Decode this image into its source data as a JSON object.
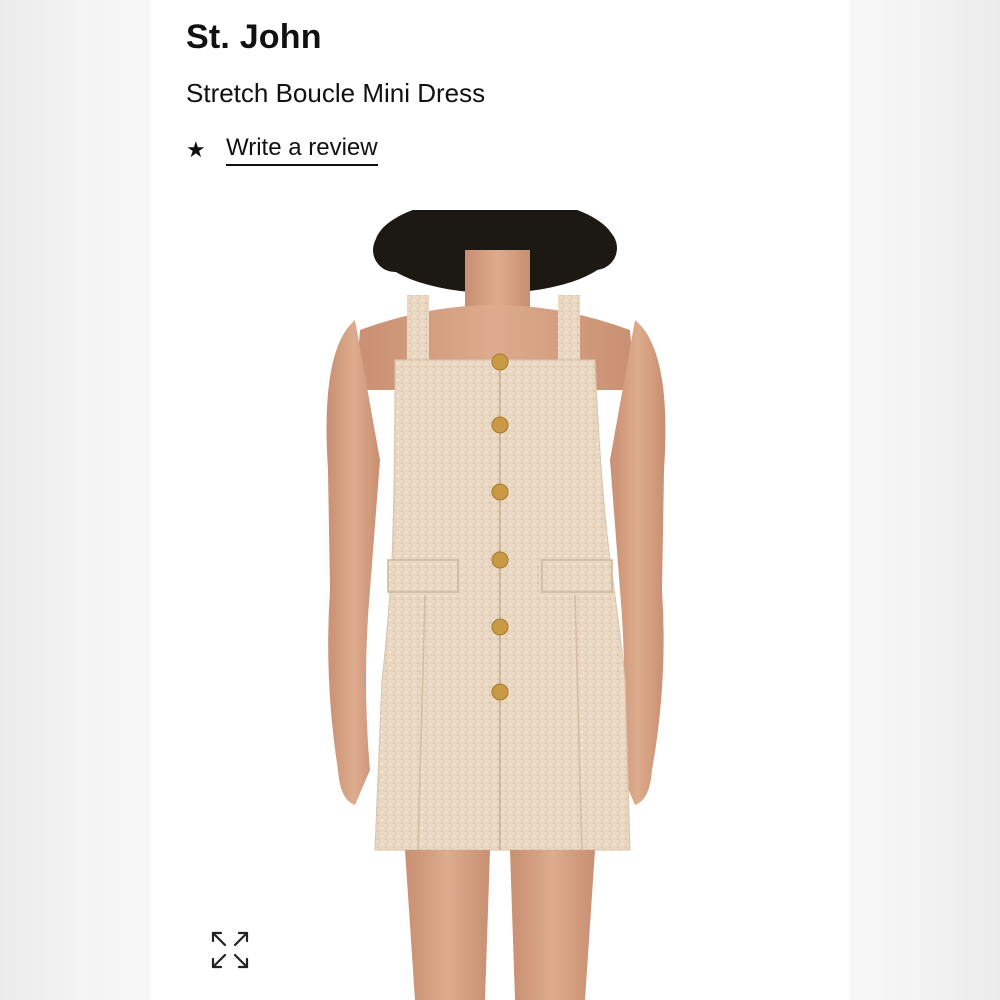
{
  "product": {
    "brand": "St. John",
    "name": "Stretch Boucle Mini Dress",
    "review_link": "Write a review"
  },
  "icons": {
    "rating": "star-icon",
    "expand": "expand-arrows-icon"
  },
  "colors": {
    "text": "#111111",
    "dress_fabric": "#e8d5c0",
    "buttons_gold": "#c99a45",
    "hair": "#1c1814",
    "skin": "#d8a586"
  }
}
